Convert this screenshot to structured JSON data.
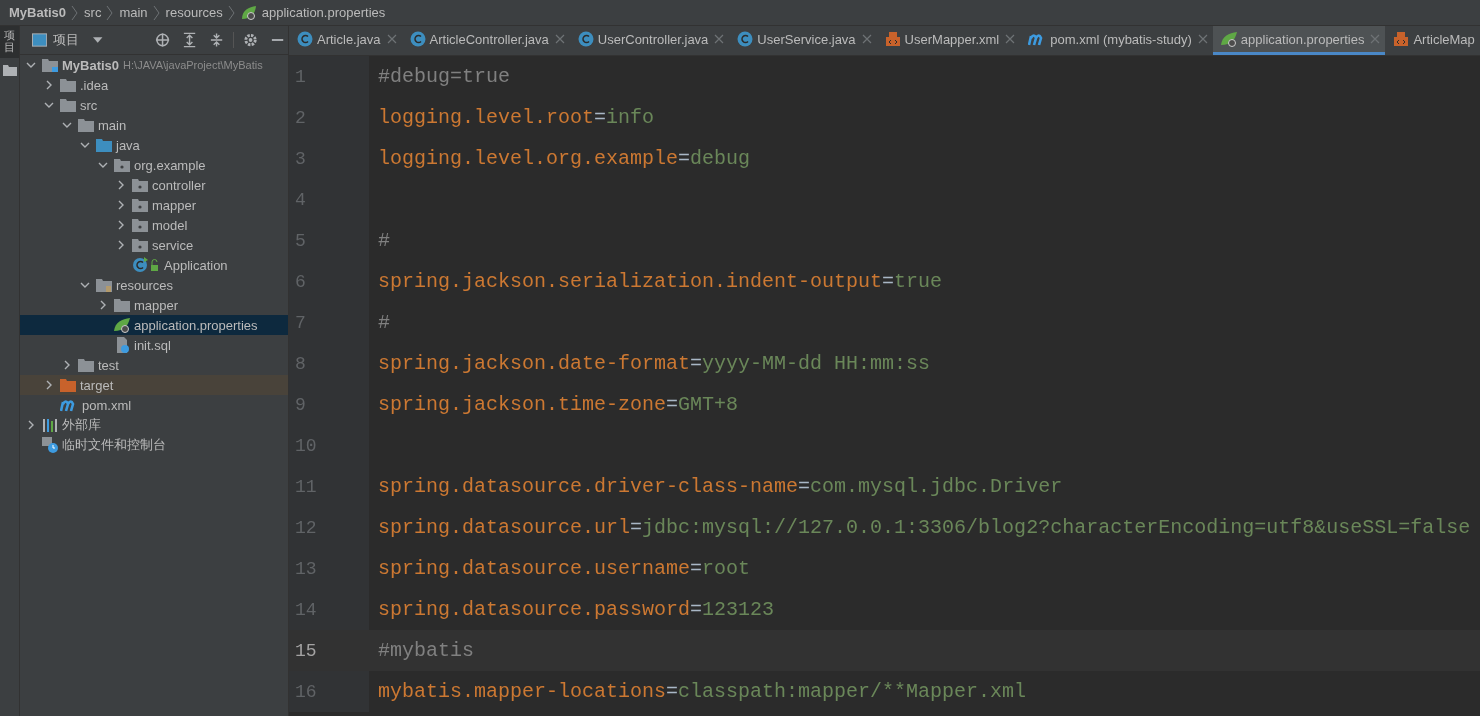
{
  "breadcrumb": [
    {
      "label": "MyBatis0",
      "kind": "project"
    },
    {
      "label": "src",
      "kind": "folder"
    },
    {
      "label": "main",
      "kind": "folder"
    },
    {
      "label": "resources",
      "kind": "folder"
    },
    {
      "label": "application.properties",
      "kind": "spring"
    }
  ],
  "tool_strip": {
    "label": "项目",
    "selected": true
  },
  "project_panel": {
    "title": "项目"
  },
  "tree": [
    {
      "label": "MyBatis0",
      "path": "H:\\JAVA\\javaProject\\MyBatis",
      "kind": "module",
      "expanded": true,
      "selected": false,
      "children": [
        {
          "label": ".idea",
          "kind": "folder",
          "expanded": false,
          "selected": false
        },
        {
          "label": "src",
          "kind": "folder",
          "expanded": true,
          "selected": false,
          "children": [
            {
              "label": "main",
              "kind": "folder",
              "expanded": true,
              "selected": false,
              "children": [
                {
                  "label": "java",
                  "kind": "source",
                  "expanded": true,
                  "selected": false,
                  "children": [
                    {
                      "label": "org.example",
                      "kind": "package",
                      "expanded": true,
                      "selected": false,
                      "children": [
                        {
                          "label": "controller",
                          "kind": "package",
                          "expanded": false,
                          "selected": false
                        },
                        {
                          "label": "mapper",
                          "kind": "package",
                          "expanded": false,
                          "selected": false
                        },
                        {
                          "label": "model",
                          "kind": "package",
                          "expanded": false,
                          "selected": false
                        },
                        {
                          "label": "service",
                          "kind": "package",
                          "expanded": false,
                          "selected": false
                        },
                        {
                          "label": "Application",
                          "kind": "spring-class",
                          "selected": false
                        }
                      ]
                    }
                  ]
                },
                {
                  "label": "resources",
                  "kind": "resources",
                  "expanded": true,
                  "selected": false,
                  "children": [
                    {
                      "label": "mapper",
                      "kind": "folder",
                      "expanded": false,
                      "selected": false
                    },
                    {
                      "label": "application.properties",
                      "kind": "spring",
                      "selected": true
                    },
                    {
                      "label": "init.sql",
                      "kind": "sql",
                      "selected": false
                    }
                  ]
                }
              ]
            },
            {
              "label": "test",
              "kind": "folder",
              "expanded": false,
              "selected": false
            }
          ]
        },
        {
          "label": "target",
          "kind": "excluded",
          "expanded": false,
          "selected": false
        },
        {
          "label": "pom.xml",
          "kind": "maven",
          "selected": false
        }
      ]
    },
    {
      "label": "外部库",
      "kind": "library",
      "expanded": false,
      "selected": false
    },
    {
      "label": "临时文件和控制台",
      "kind": "scratch",
      "selected": false
    }
  ],
  "tabs": [
    {
      "label": "Article.java",
      "kind": "class",
      "selected": false
    },
    {
      "label": "ArticleController.java",
      "kind": "class",
      "selected": false
    },
    {
      "label": "UserController.java",
      "kind": "class",
      "selected": false
    },
    {
      "label": "UserService.java",
      "kind": "class",
      "selected": false
    },
    {
      "label": "UserMapper.xml",
      "kind": "xml",
      "selected": false
    },
    {
      "label": "pom.xml (mybatis-study)",
      "kind": "maven",
      "selected": false
    },
    {
      "label": "application.properties",
      "kind": "spring",
      "selected": true
    },
    {
      "label": "ArticleMap",
      "kind": "xml",
      "selected": false
    }
  ],
  "lines": [
    {
      "number": "1",
      "kind": "comment",
      "text": "#debug=true",
      "current": false
    },
    {
      "number": "2",
      "kind": "property",
      "key": "logging.level.root",
      "eq": "=",
      "value": "info",
      "current": false
    },
    {
      "number": "3",
      "kind": "property",
      "key": "logging.level.org.example",
      "eq": "=",
      "value": "debug",
      "current": false
    },
    {
      "number": "4",
      "kind": "blank",
      "current": false
    },
    {
      "number": "5",
      "kind": "comment",
      "text": "#",
      "current": false
    },
    {
      "number": "6",
      "kind": "property",
      "key": "spring.jackson.serialization.indent-output",
      "eq": "=",
      "value": "true",
      "current": false
    },
    {
      "number": "7",
      "kind": "comment",
      "text": "#",
      "current": false
    },
    {
      "number": "8",
      "kind": "property",
      "key": "spring.jackson.date-format",
      "eq": "=",
      "value": "yyyy-MM-dd HH:mm:ss",
      "current": false
    },
    {
      "number": "9",
      "kind": "property",
      "key": "spring.jackson.time-zone",
      "eq": "=",
      "value": "GMT+8",
      "current": false
    },
    {
      "number": "10",
      "kind": "blank",
      "current": false
    },
    {
      "number": "11",
      "kind": "property",
      "key": "spring.datasource.driver-class-name",
      "eq": "=",
      "value": "com.mysql.jdbc.Driver",
      "current": false
    },
    {
      "number": "12",
      "kind": "property",
      "key": "spring.datasource.url",
      "eq": "=",
      "value": "jdbc:mysql://127.0.0.1:3306/blog2?characterEncoding=utf8&useSSL=false",
      "current": false
    },
    {
      "number": "13",
      "kind": "property",
      "key": "spring.datasource.username",
      "eq": "=",
      "value": "root",
      "current": false
    },
    {
      "number": "14",
      "kind": "property",
      "key": "spring.datasource.password",
      "eq": "=",
      "value": "123123",
      "current": false
    },
    {
      "number": "15",
      "kind": "comment",
      "text": "#mybatis",
      "current": true
    },
    {
      "number": "16",
      "kind": "property",
      "key": "mybatis.mapper-locations",
      "eq": "=",
      "value": "classpath:mapper/**Mapper.xml",
      "current": false
    }
  ]
}
